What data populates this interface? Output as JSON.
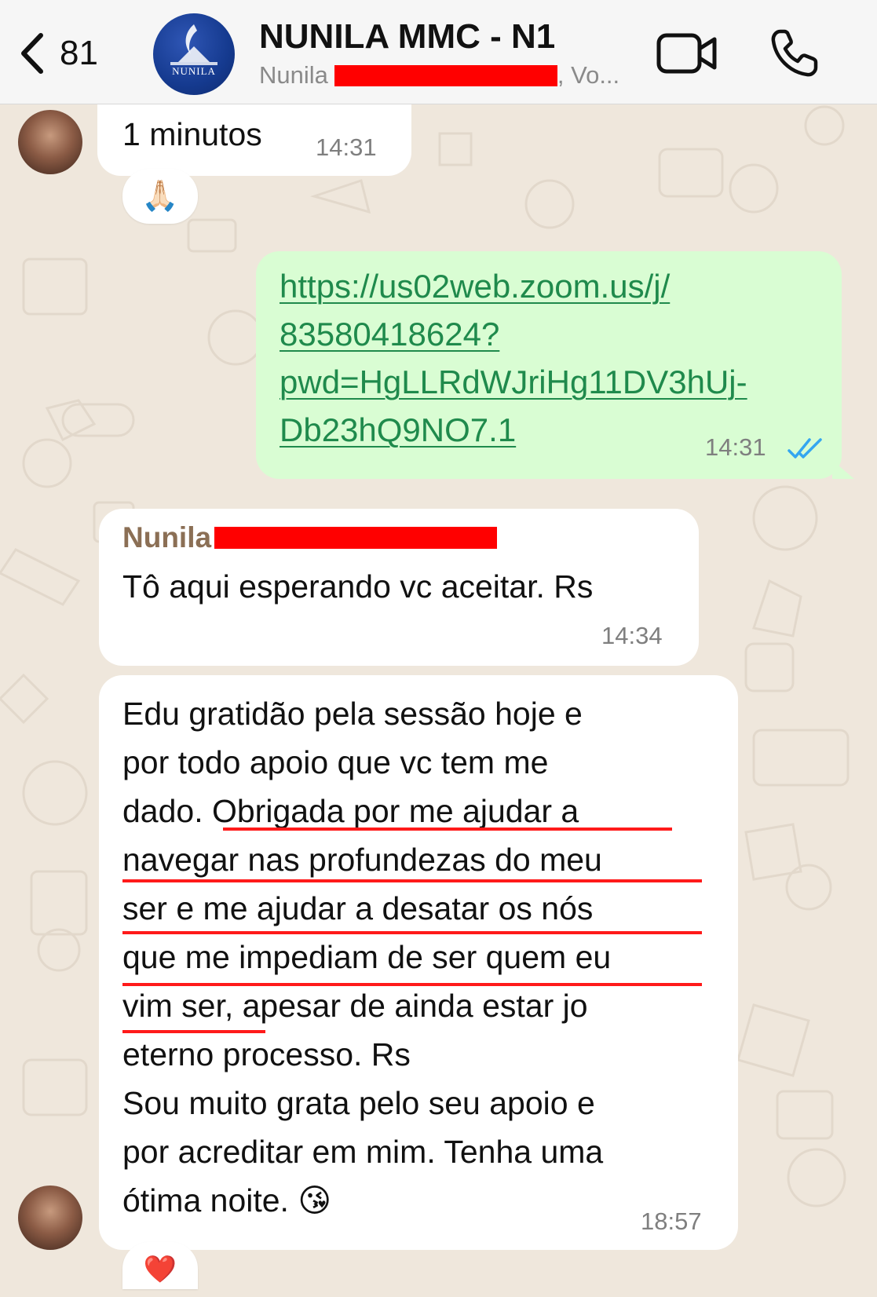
{
  "header": {
    "back_count": "81",
    "title": "NUNILA MMC - N1",
    "subtitle_prefix": "Nunila",
    "subtitle_suffix": ", Vo...",
    "avatar_logo_text": "NUNILA"
  },
  "messages": [
    {
      "direction": "incoming",
      "text": "1 minutos",
      "time": "14:31",
      "reaction": "🙏🏻"
    },
    {
      "direction": "outgoing",
      "link_lines": [
        "https://us02web.zoom.us/j/",
        "83580418624?",
        "pwd=HgLLRdWJriHg11DV3hUj-",
        "Db23hQ9NO7.1"
      ],
      "time": "14:31",
      "status": "read"
    },
    {
      "direction": "incoming",
      "sender": "Nunila",
      "text": "Tô aqui esperando vc aceitar. Rs",
      "time": "14:34"
    },
    {
      "direction": "incoming",
      "lines": [
        "Edu gratidão pela sessão hoje e",
        "por todo apoio que vc tem me",
        "dado. Obrigada por me ajudar a",
        "navegar nas profundezas do meu",
        "ser e me ajudar a desatar os nós",
        "que me impediam de ser quem eu",
        "vim ser, apesar de ainda estar jo",
        "eterno processo. Rs",
        "Sou muito grata pelo seu apoio e",
        "por acreditar em mim. Tenha uma",
        "ótima noite. 😘"
      ],
      "time": "18:57",
      "reaction": "❤️"
    }
  ],
  "icons": {
    "back": "chevron-left-icon",
    "video": "video-camera-icon",
    "call": "phone-icon",
    "read_receipt": "double-check-icon"
  },
  "colors": {
    "outgoing_bubble": "#d9fdd3",
    "incoming_bubble": "#ffffff",
    "link": "#1f8a4c",
    "read_check": "#34a6f0",
    "sender_name": "#8b6f55",
    "redaction": "#ff0000",
    "annotation_underline": "#ff1a1a"
  }
}
